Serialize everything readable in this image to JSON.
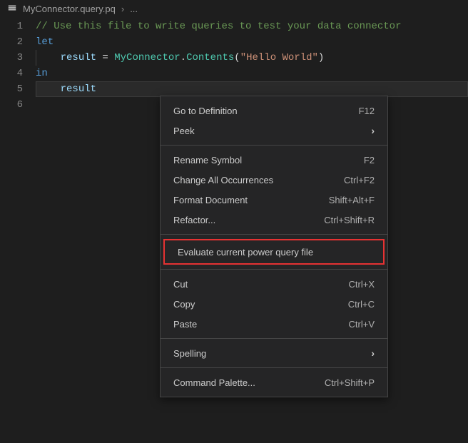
{
  "breadcrumb": {
    "filename": "MyConnector.query.pq",
    "trail": "..."
  },
  "code": {
    "lines": [
      {
        "num": "1",
        "tokens": [
          {
            "cls": "tok-comment",
            "text": "// Use this file to write queries to test your data connector"
          }
        ]
      },
      {
        "num": "2",
        "tokens": [
          {
            "cls": "tok-keyword",
            "text": "let"
          }
        ]
      },
      {
        "num": "3",
        "tokens": [
          {
            "cls": "tok-ident",
            "text": "result"
          },
          {
            "cls": "tok-op",
            "text": " = "
          },
          {
            "cls": "tok-type",
            "text": "MyConnector"
          },
          {
            "cls": "tok-op",
            "text": "."
          },
          {
            "cls": "tok-type",
            "text": "Contents"
          },
          {
            "cls": "tok-op",
            "text": "("
          },
          {
            "cls": "tok-string",
            "text": "\"Hello World\""
          },
          {
            "cls": "tok-op",
            "text": ")"
          }
        ],
        "indent": true
      },
      {
        "num": "4",
        "tokens": [
          {
            "cls": "tok-keyword",
            "text": "in"
          }
        ]
      },
      {
        "num": "5",
        "tokens": [
          {
            "cls": "tok-ident",
            "text": "result"
          }
        ],
        "indent": true,
        "active": true
      },
      {
        "num": "6",
        "tokens": []
      }
    ]
  },
  "menu": {
    "groups": [
      [
        {
          "label": "Go to Definition",
          "shortcut": "F12",
          "submenu": false
        },
        {
          "label": "Peek",
          "shortcut": "",
          "submenu": true
        }
      ],
      [
        {
          "label": "Rename Symbol",
          "shortcut": "F2",
          "submenu": false
        },
        {
          "label": "Change All Occurrences",
          "shortcut": "Ctrl+F2",
          "submenu": false
        },
        {
          "label": "Format Document",
          "shortcut": "Shift+Alt+F",
          "submenu": false
        },
        {
          "label": "Refactor...",
          "shortcut": "Ctrl+Shift+R",
          "submenu": false
        }
      ],
      [
        {
          "label": "Evaluate current power query file",
          "shortcut": "",
          "submenu": false,
          "highlight": true
        }
      ],
      [
        {
          "label": "Cut",
          "shortcut": "Ctrl+X",
          "submenu": false
        },
        {
          "label": "Copy",
          "shortcut": "Ctrl+C",
          "submenu": false
        },
        {
          "label": "Paste",
          "shortcut": "Ctrl+V",
          "submenu": false
        }
      ],
      [
        {
          "label": "Spelling",
          "shortcut": "",
          "submenu": true
        }
      ],
      [
        {
          "label": "Command Palette...",
          "shortcut": "Ctrl+Shift+P",
          "submenu": false
        }
      ]
    ]
  }
}
